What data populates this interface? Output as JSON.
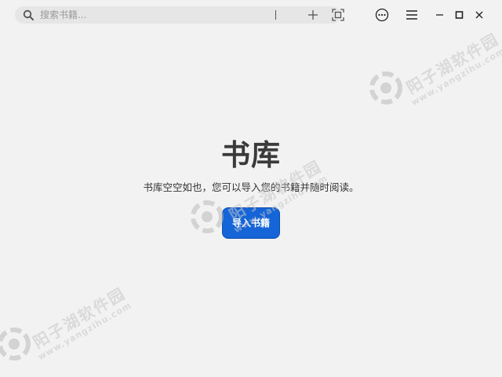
{
  "search": {
    "placeholder": "搜索书籍...",
    "value": ""
  },
  "toolbar": {
    "search_icon": "search-icon",
    "add_icon": "plus-icon",
    "scan_icon": "scan-icon",
    "more_icon": "more-horizontal-icon",
    "menu_icon": "hamburger-menu-icon",
    "minimize_icon": "minimize-icon",
    "maximize_icon": "maximize-icon",
    "close_icon": "close-icon"
  },
  "main": {
    "title": "书库",
    "subtitle": "书库空空如也，您可以导入您的书籍并随时阅读。",
    "import_button": "导入书籍"
  },
  "watermark": {
    "name": "阳子湖软件园",
    "url": "www.yangzihu.com"
  },
  "colors": {
    "background": "#f2f2f2",
    "accent": "#1565d8",
    "search_bg": "#e6e6e6"
  }
}
